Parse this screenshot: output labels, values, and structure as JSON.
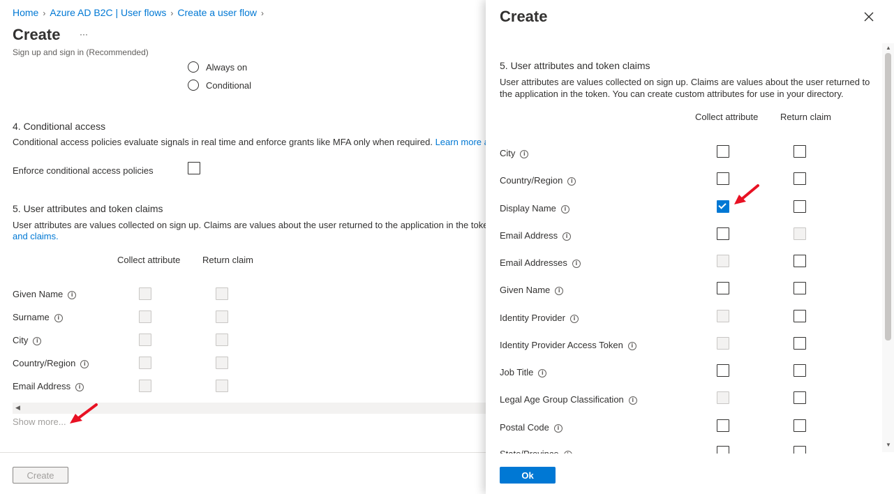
{
  "breadcrumb": {
    "home": "Home",
    "b2c": "Azure AD B2C | User flows",
    "create_flow": "Create a user flow"
  },
  "page": {
    "title": "Create",
    "more": "···",
    "subtitle": "Sign up and sign in (Recommended)"
  },
  "mfa_options": {
    "always_on": "Always on",
    "conditional": "Conditional"
  },
  "conditional_access": {
    "heading": "4. Conditional access",
    "description": "Conditional access policies evaluate signals in real time and enforce grants like MFA only when required.",
    "learn_more": "Learn more ab",
    "enforce_label": "Enforce conditional access policies"
  },
  "attributes": {
    "heading": "5. User attributes and token claims",
    "description": "User attributes are values collected on sign up. Claims are values about the user returned to the application in the toke",
    "link_tail": "and claims.",
    "col_collect": "Collect attribute",
    "col_return": "Return claim",
    "rows": [
      {
        "label": "Given Name"
      },
      {
        "label": "Surname"
      },
      {
        "label": "City"
      },
      {
        "label": "Country/Region"
      },
      {
        "label": "Email Address"
      }
    ],
    "show_more": "Show more..."
  },
  "footer": {
    "create_label": "Create"
  },
  "panel": {
    "title": "Create",
    "heading": "5. User attributes and token claims",
    "description": "User attributes are values collected on sign up. Claims are values about the user returned to the application in the token. You can create custom attributes for use in your directory.",
    "col_collect": "Collect attribute",
    "col_return": "Return claim",
    "rows": [
      {
        "label": "City",
        "collect": "unchecked",
        "return": "unchecked"
      },
      {
        "label": "Country/Region",
        "collect": "unchecked",
        "return": "unchecked"
      },
      {
        "label": "Display Name",
        "collect": "checked",
        "return": "unchecked"
      },
      {
        "label": "Email Address",
        "collect": "unchecked",
        "return": "disabled"
      },
      {
        "label": "Email Addresses",
        "collect": "disabled",
        "return": "unchecked"
      },
      {
        "label": "Given Name",
        "collect": "unchecked",
        "return": "unchecked"
      },
      {
        "label": "Identity Provider",
        "collect": "disabled",
        "return": "unchecked"
      },
      {
        "label": "Identity Provider Access Token",
        "collect": "disabled",
        "return": "unchecked"
      },
      {
        "label": "Job Title",
        "collect": "unchecked",
        "return": "unchecked"
      },
      {
        "label": "Legal Age Group Classification",
        "collect": "disabled",
        "return": "unchecked"
      },
      {
        "label": "Postal Code",
        "collect": "unchecked",
        "return": "unchecked"
      },
      {
        "label": "State/Province",
        "collect": "unchecked",
        "return": "unchecked"
      }
    ],
    "ok_label": "Ok"
  },
  "colors": {
    "accent": "#0078d4",
    "annotation_arrow": "#e81123"
  }
}
